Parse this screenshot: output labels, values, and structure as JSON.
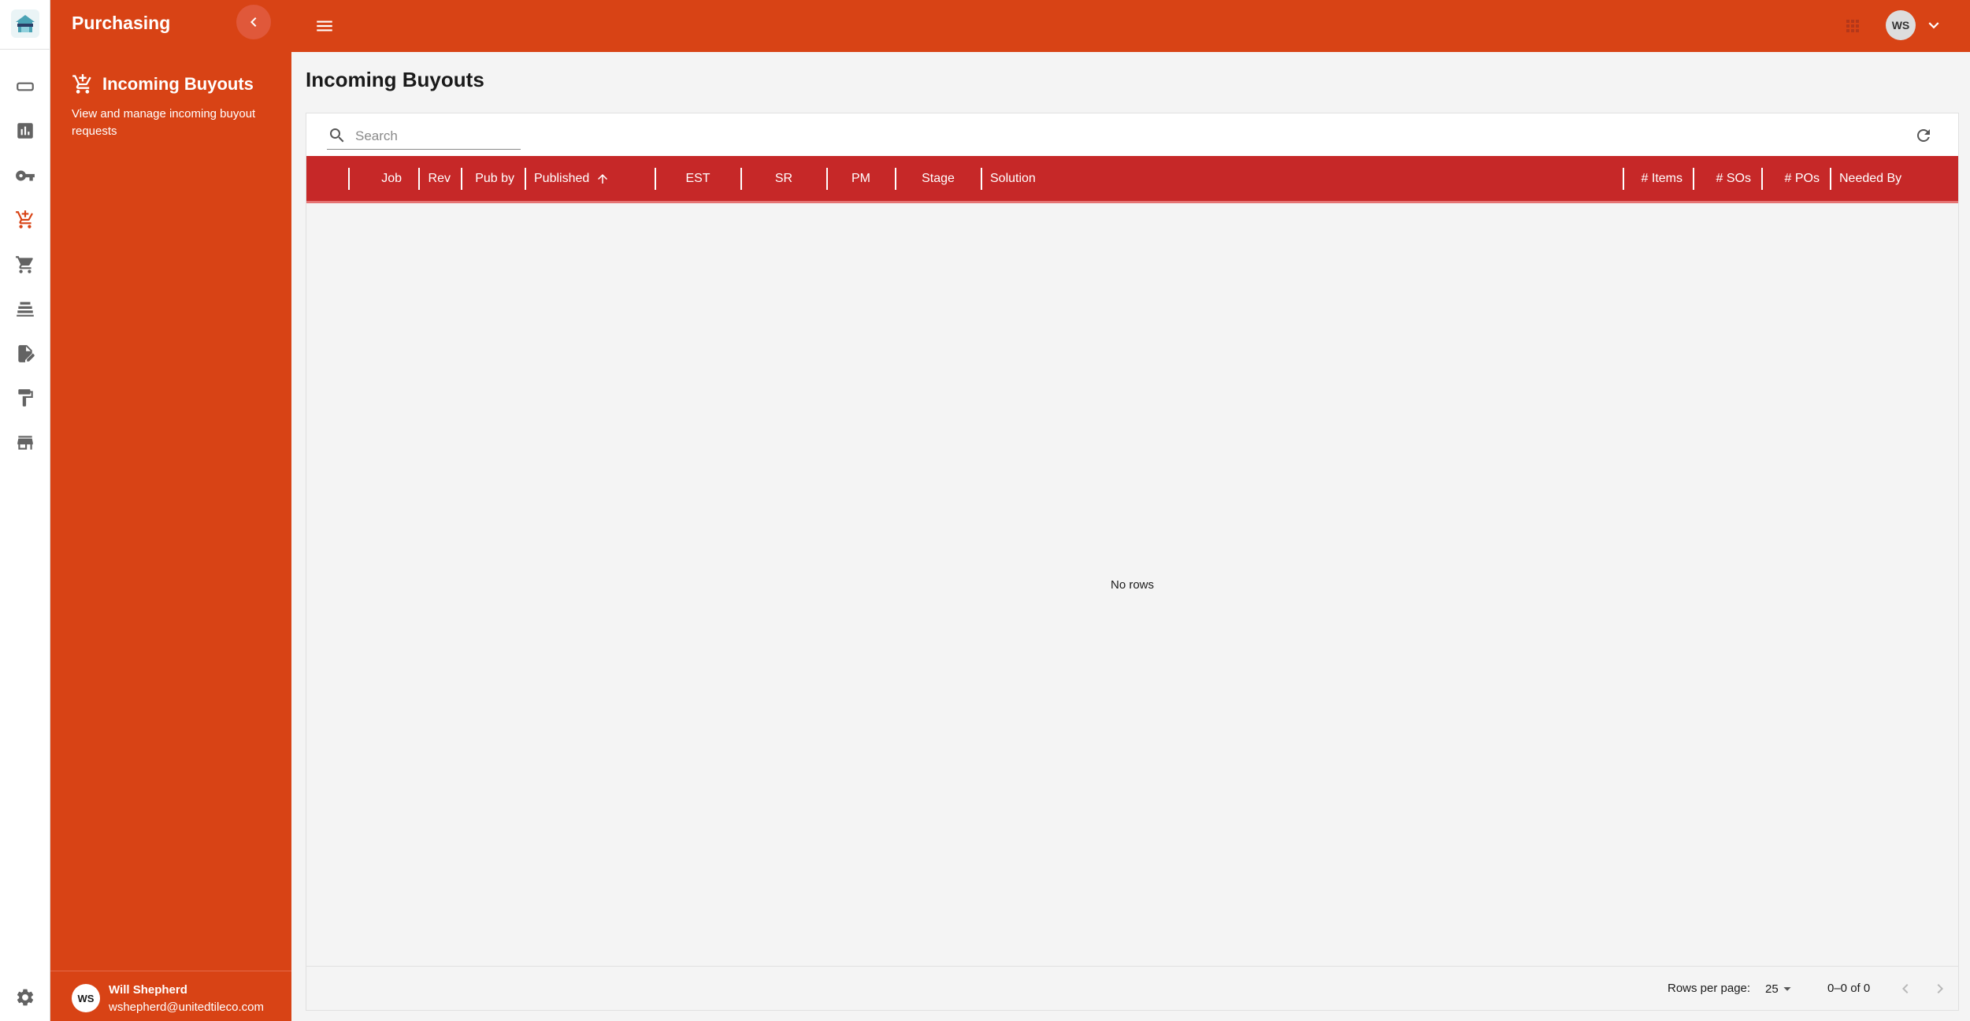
{
  "app": {
    "section_title": "Purchasing",
    "nav_item": {
      "label": "Incoming Buyouts",
      "description": "View and manage incoming buyout requests"
    },
    "user": {
      "initials": "WS",
      "name": "Will Shepherd",
      "email": "wshepherd@unitedtileco.com"
    }
  },
  "rail": {
    "icons": [
      "app-logo",
      "rounded-rect-icon",
      "analytics-icon",
      "key-icon",
      "cart-add-icon",
      "shopping-cart-icon",
      "stack-icon",
      "document-edit-icon",
      "paint-roller-icon",
      "storefront-icon",
      "settings-icon"
    ],
    "active": "cart-add-icon"
  },
  "page": {
    "title": "Incoming Buyouts"
  },
  "grid": {
    "search_placeholder": "Search",
    "columns": [
      "Job",
      "Rev",
      "Pub by",
      "Published",
      "EST",
      "SR",
      "PM",
      "Stage",
      "Solution",
      "# Items",
      "# SOs",
      "# POs",
      "Needed By"
    ],
    "sorted_column": "Published",
    "sort_direction": "ascending",
    "empty_text": "No rows",
    "footer": {
      "rows_per_page_label": "Rows per page:",
      "rows_per_page_value": "25",
      "range_text": "0–0 of 0"
    }
  },
  "colors": {
    "primary": "#d84315",
    "header": "#c62828",
    "active_icon": "#d84315"
  }
}
